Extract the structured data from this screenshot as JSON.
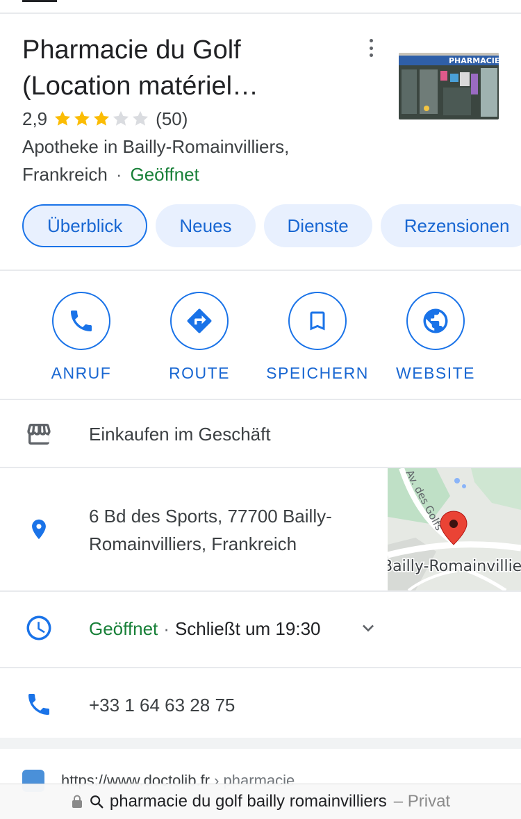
{
  "place": {
    "title_line1": "Pharmacie du Golf",
    "title_line2": "(Location matériel…",
    "rating": "2,9",
    "stars_filled": 3,
    "stars_total": 5,
    "review_count": "(50)",
    "category_line": "Apotheke in Bailly-Romainvilliers,",
    "country": "Frankreich",
    "separator": "·",
    "status": "Geöffnet"
  },
  "tabs": [
    {
      "label": "Überblick",
      "active": true
    },
    {
      "label": "Neues",
      "active": false
    },
    {
      "label": "Dienste",
      "active": false
    },
    {
      "label": "Rezensionen",
      "active": false
    }
  ],
  "actions": [
    {
      "label": "ANRUF",
      "icon": "phone-icon"
    },
    {
      "label": "ROUTE",
      "icon": "directions-icon"
    },
    {
      "label": "SPEICHERN",
      "icon": "bookmark-icon"
    },
    {
      "label": "WEBSITE",
      "icon": "globe-icon"
    }
  ],
  "shopping": {
    "label": "Einkaufen im Geschäft",
    "icon": "storefront-icon"
  },
  "address": {
    "line1": "6 Bd des Sports, 77700 Bailly-",
    "line2": "Romainvilliers, Frankreich",
    "icon": "location-pin-icon",
    "map_labels": {
      "street": "Av. des Golfs",
      "town": "Bailly-Romainvilliers"
    }
  },
  "hours": {
    "status": "Geöffnet",
    "separator": "·",
    "closes": "Schließt um 19:30",
    "icon": "clock-icon"
  },
  "phone": {
    "number": "+33 1 64 63 28 75",
    "icon": "phone-icon"
  },
  "website_preview": {
    "url": "https://www.doctolib.fr",
    "path": "› pharmacie"
  },
  "browser_bar": {
    "query": "pharmacie du golf bailly romainvilliers",
    "mode": "– Privat"
  },
  "colors": {
    "accent_blue": "#1a73e8",
    "open_green": "#188038",
    "star_gold": "#fbbc04",
    "pin_red": "#ea4335"
  }
}
